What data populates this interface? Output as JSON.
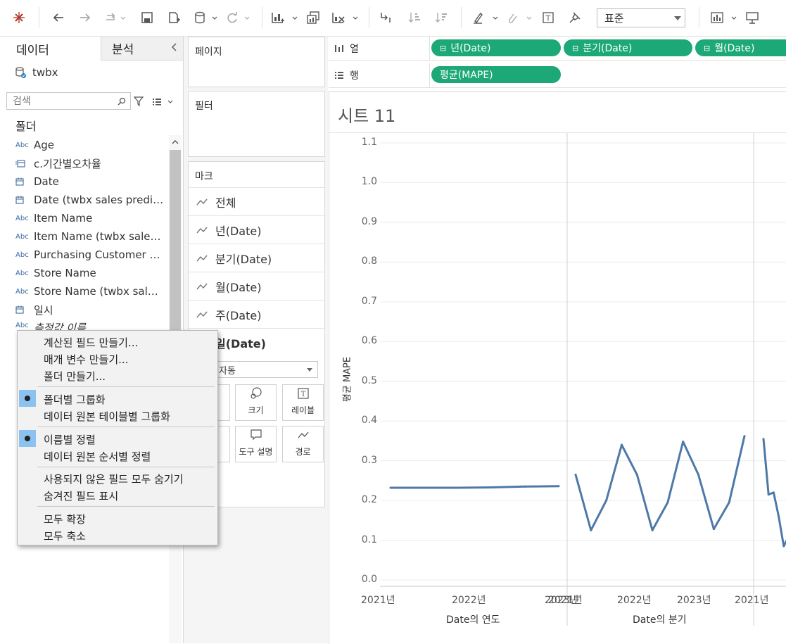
{
  "toolbar": {
    "icons": [
      "tableau-logo-icon",
      "undo-icon",
      "redo-icon",
      "replay-icon",
      "save-icon",
      "new-datasource-icon",
      "datasource-icon",
      "refresh-icon",
      "new-worksheet-icon",
      "duplicate-icon",
      "clear-icon",
      "swap-icon",
      "sort-asc-icon",
      "sort-desc-icon",
      "highlight-icon",
      "group-icon",
      "label-icon",
      "pin-icon",
      "show-me-icon",
      "presentation-icon"
    ],
    "fit_select": "표준"
  },
  "left_pane": {
    "tabs": {
      "data": "데이터",
      "analytics": "분석"
    },
    "datasource": "twbx",
    "search_placeholder": "검색",
    "folder_header": "폴더",
    "fields": [
      {
        "type": "Abc",
        "name": "Age"
      },
      {
        "type": "calc-date",
        "name": "c.기간별오차율"
      },
      {
        "type": "date",
        "name": "Date"
      },
      {
        "type": "date",
        "name": "Date (twbx sales predict ..."
      },
      {
        "type": "Abc",
        "name": "Item Name"
      },
      {
        "type": "Abc",
        "name": "Item Name (twbx sales p..."
      },
      {
        "type": "Abc",
        "name": "Purchasing Customer Ge..."
      },
      {
        "type": "Abc",
        "name": "Store Name"
      },
      {
        "type": "Abc",
        "name": "Store Name (twbx sales ..."
      },
      {
        "type": "date",
        "name": "일시"
      },
      {
        "type": "Abc",
        "name": "측정값 이름"
      }
    ]
  },
  "cards": {
    "pages": "페이지",
    "filters": "필터",
    "marks": "마크",
    "mark_rows": [
      "전체",
      "년(Date)",
      "분기(Date)",
      "월(Date)",
      "주(Date)",
      "일(Date)"
    ],
    "mark_type": "자동",
    "mark_buttons": [
      "크기",
      "레이블",
      "도구 설명",
      "경로"
    ]
  },
  "shelves": {
    "columns_label": "열",
    "rows_label": "행",
    "column_pills": [
      "년(Date)",
      "분기(Date)",
      "월(Date)"
    ],
    "row_pills": [
      "평균(MAPE)"
    ]
  },
  "sheet": {
    "title": "시트 11"
  },
  "chart_data": {
    "type": "line",
    "ylabel": "평균 MAPE",
    "ylim": [
      0.0,
      1.1
    ],
    "yticks": [
      "1.1",
      "1.0",
      "0.9",
      "0.8",
      "0.7",
      "0.6",
      "0.5",
      "0.4",
      "0.3",
      "0.2",
      "0.1",
      "0.0"
    ],
    "panes": [
      {
        "xlabel": "Date의 연도",
        "ticks": [
          "2021년",
          "2022년",
          "2023년"
        ],
        "values": [
          0.232,
          0.232,
          0.232,
          0.233,
          0.235,
          0.236
        ]
      },
      {
        "xlabel": "Date의 분기",
        "ticks": [
          "2021년",
          "2022년",
          "2023년"
        ],
        "values": [
          0.265,
          0.125,
          0.2,
          0.34,
          0.265,
          0.125,
          0.195,
          0.348,
          0.265,
          0.128,
          0.195,
          0.362
        ]
      },
      {
        "xlabel": "",
        "ticks": [
          "2021년"
        ],
        "values": [
          0.355,
          0.215,
          0.22,
          0.16,
          0.085,
          0.11
        ]
      }
    ],
    "color": "#4e79a7",
    "grid": true
  },
  "context_menu": {
    "items": [
      {
        "label": "계산된 필드 만들기...",
        "checked": false
      },
      {
        "label": "매개 변수 만들기...",
        "checked": false
      },
      {
        "label": "폴더 만들기...",
        "checked": false
      },
      {
        "label": "폴더별 그룹화",
        "checked": true
      },
      {
        "label": "데이터 원본 테이블별 그룹화",
        "checked": false
      },
      {
        "label": "이름별 정렬",
        "checked": true
      },
      {
        "label": "데이터 원본 순서별 정렬",
        "checked": false
      },
      {
        "label": "사용되지 않은 필드 모두 숨기기",
        "checked": false
      },
      {
        "label": "숨겨진 필드 표시",
        "checked": false
      },
      {
        "label": "모두 확장",
        "checked": false
      },
      {
        "label": "모두 축소",
        "checked": false
      }
    ]
  }
}
